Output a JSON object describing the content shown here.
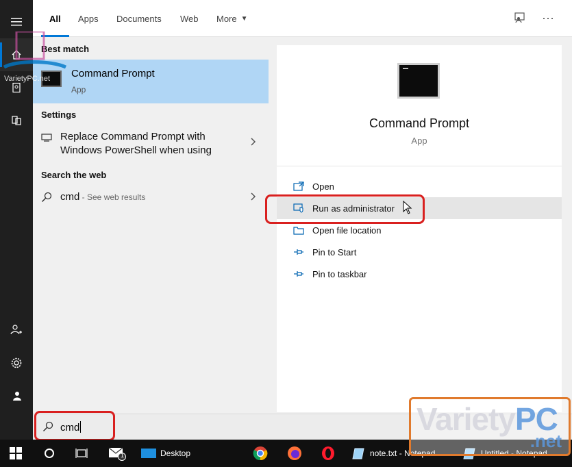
{
  "tabs": {
    "items": [
      "All",
      "Apps",
      "Documents",
      "Web",
      "More"
    ]
  },
  "best_match": {
    "heading": "Best match",
    "title": "Command Prompt",
    "subtitle": "App"
  },
  "settings": {
    "heading": "Settings",
    "line1": "Replace Command Prompt with",
    "line2": "Windows PowerShell when using"
  },
  "web": {
    "heading": "Search the web",
    "query": "cmd",
    "suffix": " - See web results"
  },
  "detail": {
    "title": "Command Prompt",
    "subtitle": "App",
    "actions": [
      "Open",
      "Run as administrator",
      "Open file location",
      "Pin to Start",
      "Pin to taskbar"
    ]
  },
  "search": {
    "value": "cmd"
  },
  "taskbar": {
    "desktop": "Desktop",
    "notepad1": "note.txt - Notepad",
    "notepad2": "Untitled - Notepad",
    "mail_badge": "1"
  },
  "watermark": {
    "small": "VarietyPC.net",
    "brand_a": "Variety",
    "brand_b": "PC",
    "domain": ".net"
  },
  "colors": {
    "accent": "#0078d7",
    "highlight": "#d9201f",
    "selected": "#b0d6f5"
  }
}
